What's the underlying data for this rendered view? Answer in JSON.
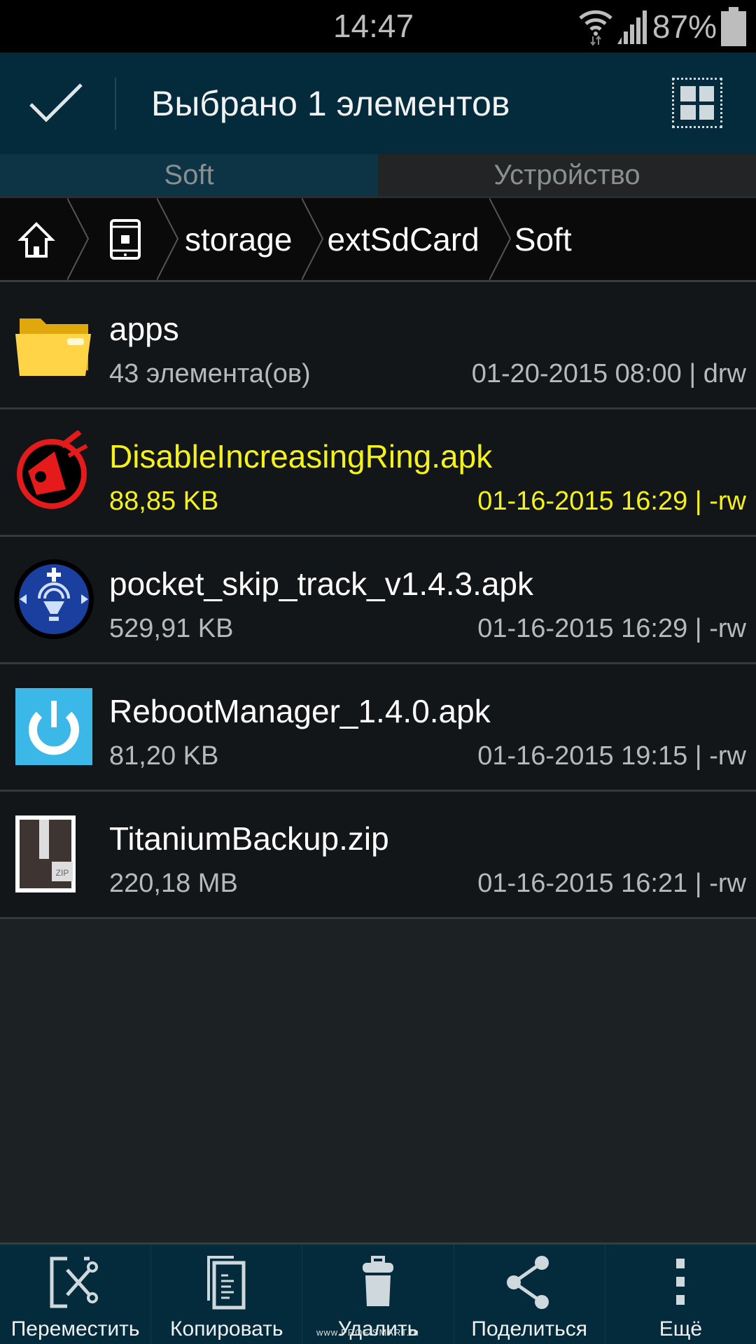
{
  "status_bar": {
    "time": "14:47",
    "battery_percent": "87%",
    "icons": [
      "wifi-icon",
      "signal-icon",
      "battery-icon"
    ]
  },
  "action_bar": {
    "title": "Выбрано 1 элементов",
    "confirm_icon": "checkmark-icon",
    "view_toggle_icon": "grid-view-icon"
  },
  "tabs": [
    {
      "label": "Soft",
      "active": true
    },
    {
      "label": "Устройство",
      "active": false
    }
  ],
  "breadcrumb": {
    "items": [
      {
        "type": "icon",
        "icon": "home-icon"
      },
      {
        "type": "icon",
        "icon": "device-icon"
      },
      {
        "type": "text",
        "label": "storage"
      },
      {
        "type": "text",
        "label": "extSdCard"
      },
      {
        "type": "text",
        "label": "Soft"
      }
    ]
  },
  "files": [
    {
      "name": "apps",
      "meta": "43 элемента(ов)",
      "date": "01-20-2015 08:00 | drw",
      "icon": "folder-icon",
      "selected": false
    },
    {
      "name": "DisableIncreasingRing.apk",
      "meta": "88,85 KB",
      "date": "01-16-2015 16:29 | -rw",
      "icon": "ring-app-icon",
      "selected": true
    },
    {
      "name": "pocket_skip_track_v1.4.3.apk",
      "meta": "529,91 KB",
      "date": "01-16-2015 16:29 | -rw",
      "icon": "skip-track-app-icon",
      "selected": false
    },
    {
      "name": "RebootManager_1.4.0.apk",
      "meta": "81,20 KB",
      "date": "01-16-2015 19:15 | -rw",
      "icon": "power-app-icon",
      "selected": false
    },
    {
      "name": "TitaniumBackup.zip",
      "meta": "220,18 MB",
      "date": "01-16-2015 16:21 | -rw",
      "icon": "zip-file-icon",
      "selected": false
    }
  ],
  "bottom_bar": [
    {
      "label": "Переместить",
      "icon": "move-icon"
    },
    {
      "label": "Копировать",
      "icon": "copy-icon"
    },
    {
      "label": "Удалить",
      "icon": "trash-icon"
    },
    {
      "label": "Поделиться",
      "icon": "share-icon"
    },
    {
      "label": "Ещё",
      "icon": "more-icon"
    }
  ],
  "watermark": "www.PROFISMART.ru",
  "colors": {
    "accent_bar": "#032b3b",
    "selected_text": "#f5f21a"
  }
}
